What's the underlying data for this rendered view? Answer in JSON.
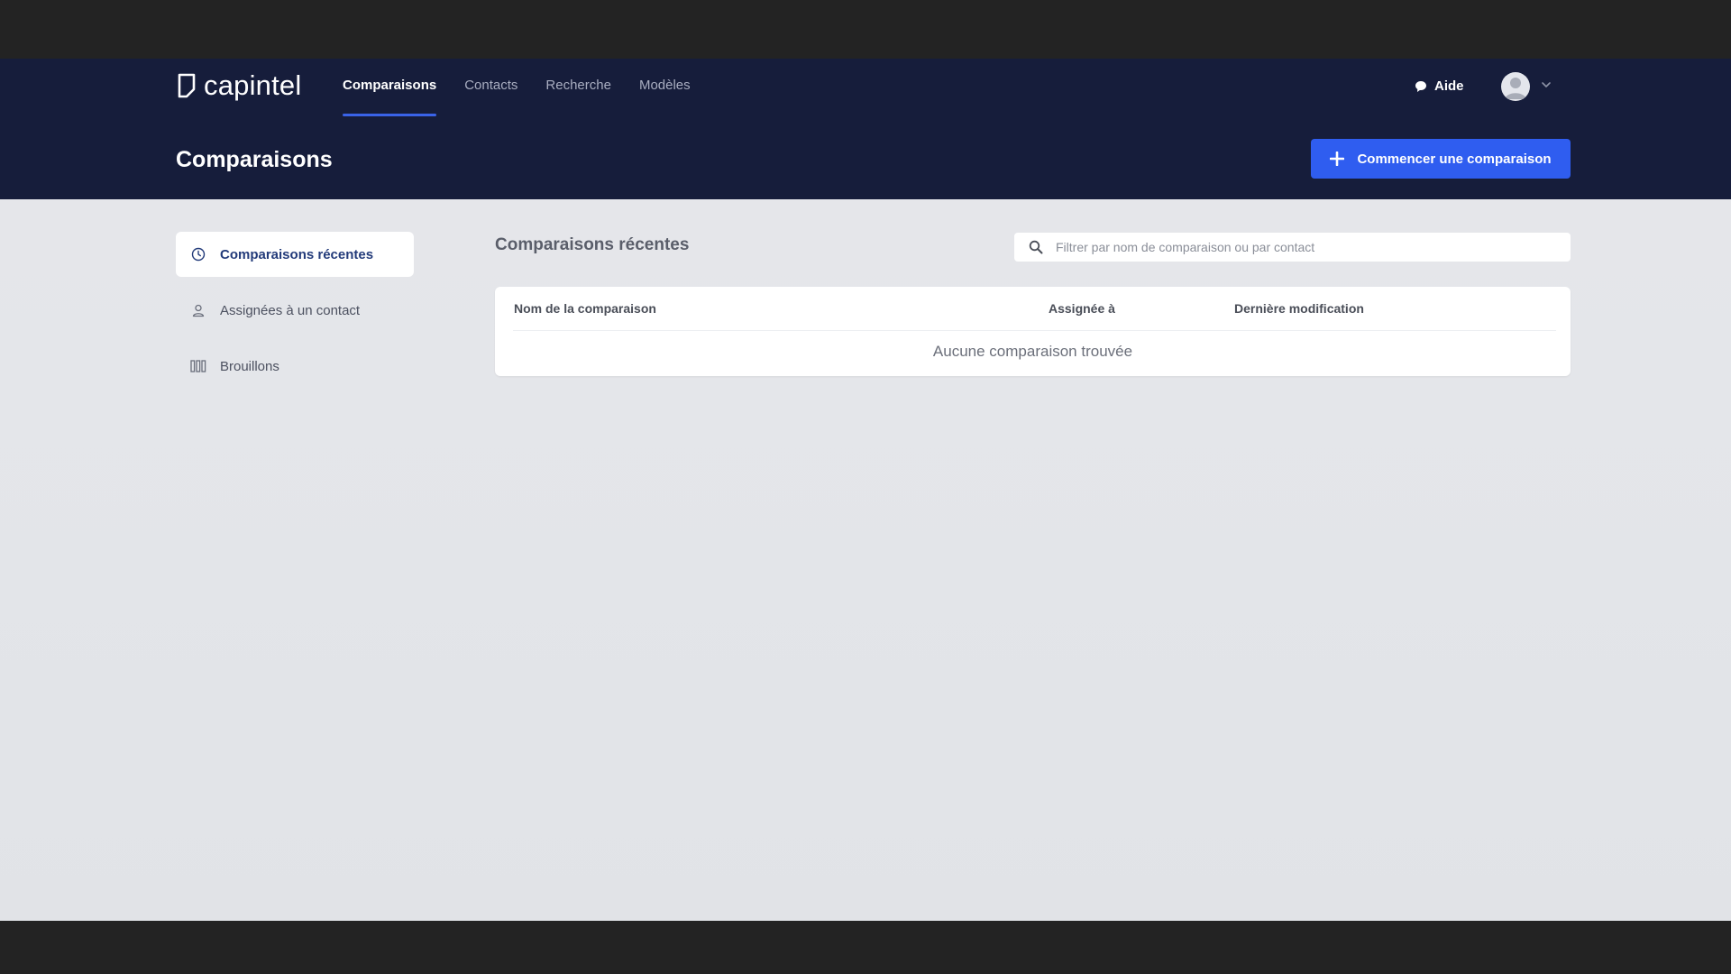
{
  "brand": {
    "name": "capintel"
  },
  "nav": {
    "tabs": [
      {
        "label": "Comparaisons",
        "active": true
      },
      {
        "label": "Contacts",
        "active": false
      },
      {
        "label": "Recherche",
        "active": false
      },
      {
        "label": "Modèles",
        "active": false
      }
    ],
    "help_label": "Aide"
  },
  "header": {
    "title": "Comparaisons",
    "primary_button": "Commencer une comparaison"
  },
  "sidebar": {
    "items": [
      {
        "label": "Comparaisons récentes",
        "icon": "clock-icon",
        "active": true
      },
      {
        "label": "Assignées à un contact",
        "icon": "user-icon",
        "active": false
      },
      {
        "label": "Brouillons",
        "icon": "columns-icon",
        "active": false
      }
    ]
  },
  "main": {
    "title": "Comparaisons récentes",
    "search": {
      "placeholder": "Filtrer par nom de comparaison ou par contact",
      "value": ""
    },
    "table": {
      "columns": [
        "Nom de la comparaison",
        "Assignée à",
        "Dernière modification"
      ],
      "empty_message": "Aucune comparaison trouvée"
    }
  },
  "colors": {
    "topbar": "#161d3b",
    "accent": "#2f5df0",
    "background": "#e4e6ea"
  }
}
